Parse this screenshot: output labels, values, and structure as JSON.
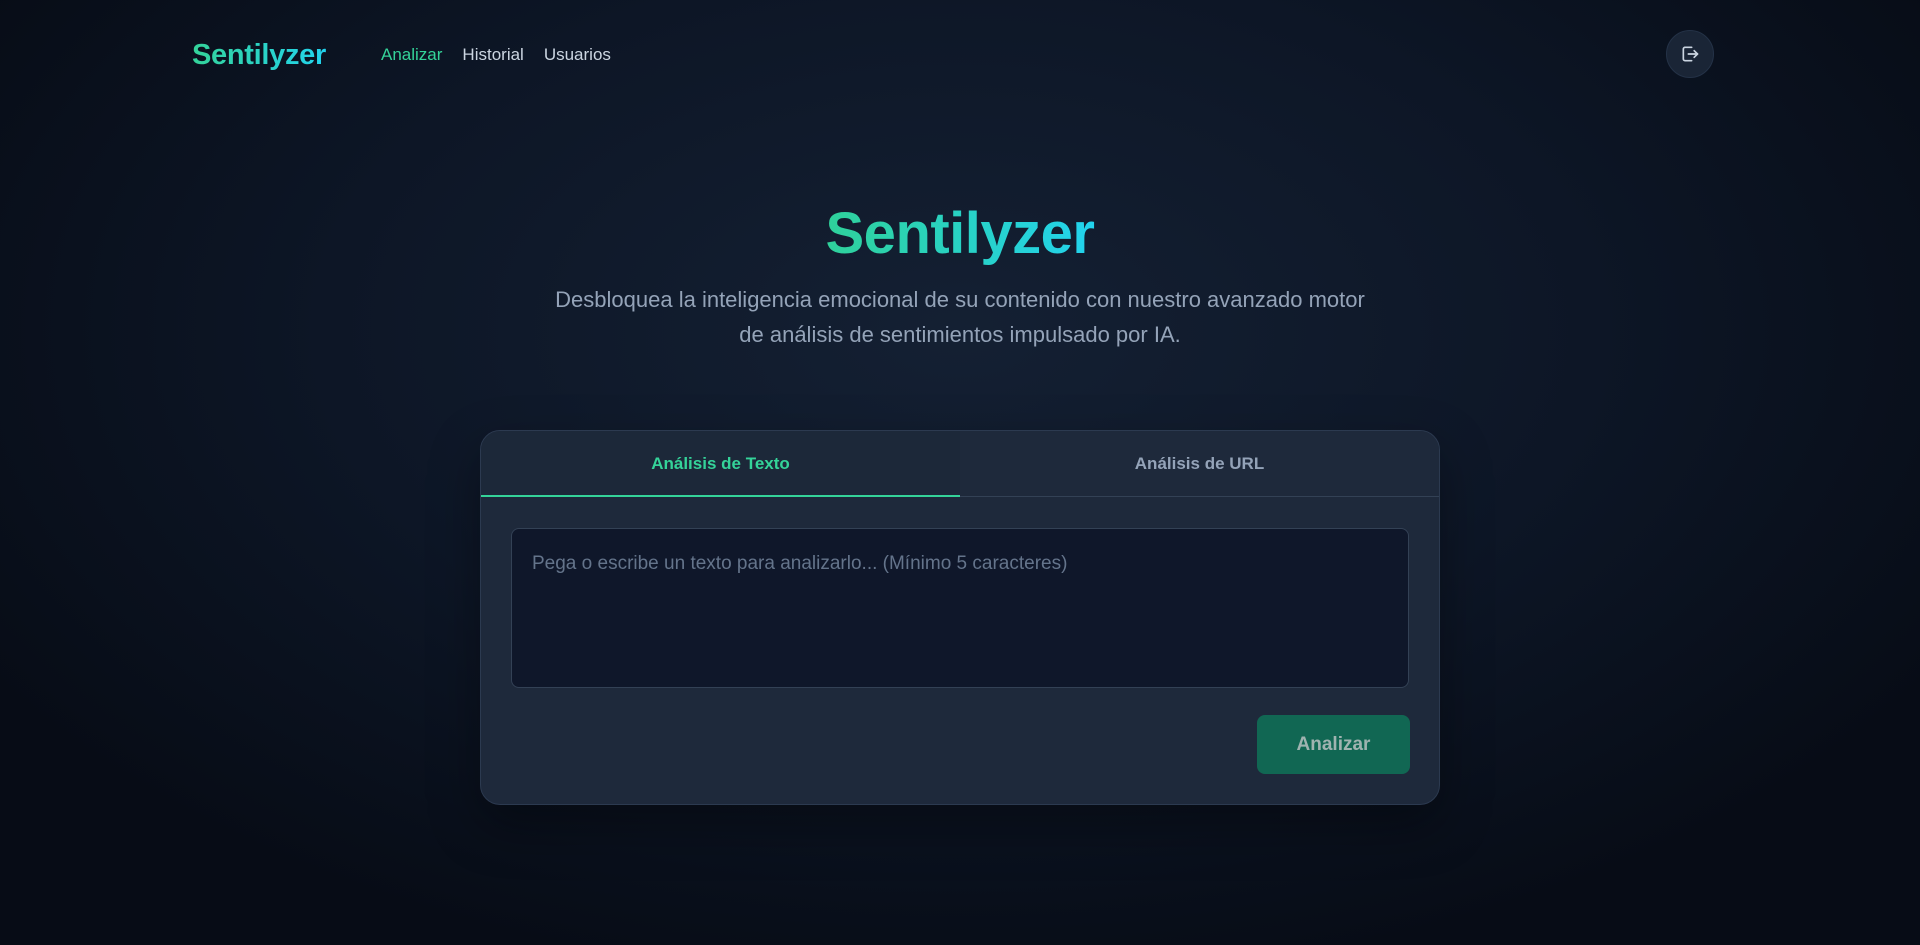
{
  "app": {
    "brand": "Sentilyzer"
  },
  "nav": {
    "items": [
      {
        "label": "Analizar",
        "active": true
      },
      {
        "label": "Historial",
        "active": false
      },
      {
        "label": "Usuarios",
        "active": false
      }
    ]
  },
  "header": {
    "logout_icon": "logout-icon"
  },
  "hero": {
    "title": "Sentilyzer",
    "subtitle": "Desbloquea la inteligencia emocional de su contenido con nuestro avanzado motor de análisis de sentimientos impulsado por IA."
  },
  "analyzer": {
    "tabs": [
      {
        "label": "Análisis de Texto",
        "active": true
      },
      {
        "label": "Análisis de URL",
        "active": false
      }
    ],
    "input": {
      "value": "",
      "placeholder": "Pega o escribe un texto para analizarlo... (Mínimo 5 caracteres)"
    },
    "submit_label": "Analizar"
  },
  "colors": {
    "accent": "#34d399",
    "accent_secondary": "#22d3ee",
    "button_bg": "#116753",
    "card_bg": "#1e293b",
    "page_bg": "#0d1626"
  }
}
